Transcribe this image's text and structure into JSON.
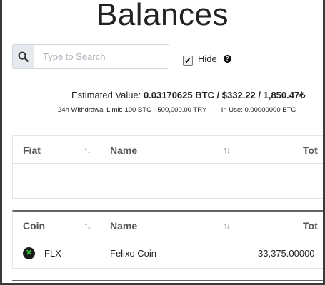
{
  "page": {
    "title": "Balances"
  },
  "search": {
    "placeholder": "Type to Search",
    "icon": "search-icon"
  },
  "hide": {
    "label": "Hide",
    "checked": true
  },
  "summary": {
    "estimated_label": "Estimated Value:",
    "estimated_value": "0.03170625 BTC / $332.22 / 1,850.47₺",
    "withdrawal_limit": "24h Withdrawal Limit: 100 BTC - 500,000.00 TRY",
    "in_use": "In Use: 0.00000000 BTC"
  },
  "fiat_table": {
    "headers": [
      "Fiat",
      "Name",
      "Tot"
    ]
  },
  "coin_table": {
    "headers": [
      "Coin",
      "Name",
      "Tot"
    ],
    "rows": [
      {
        "symbol": "FLX",
        "name": "Felixo Coin",
        "total": "33,375.00000"
      }
    ]
  }
}
